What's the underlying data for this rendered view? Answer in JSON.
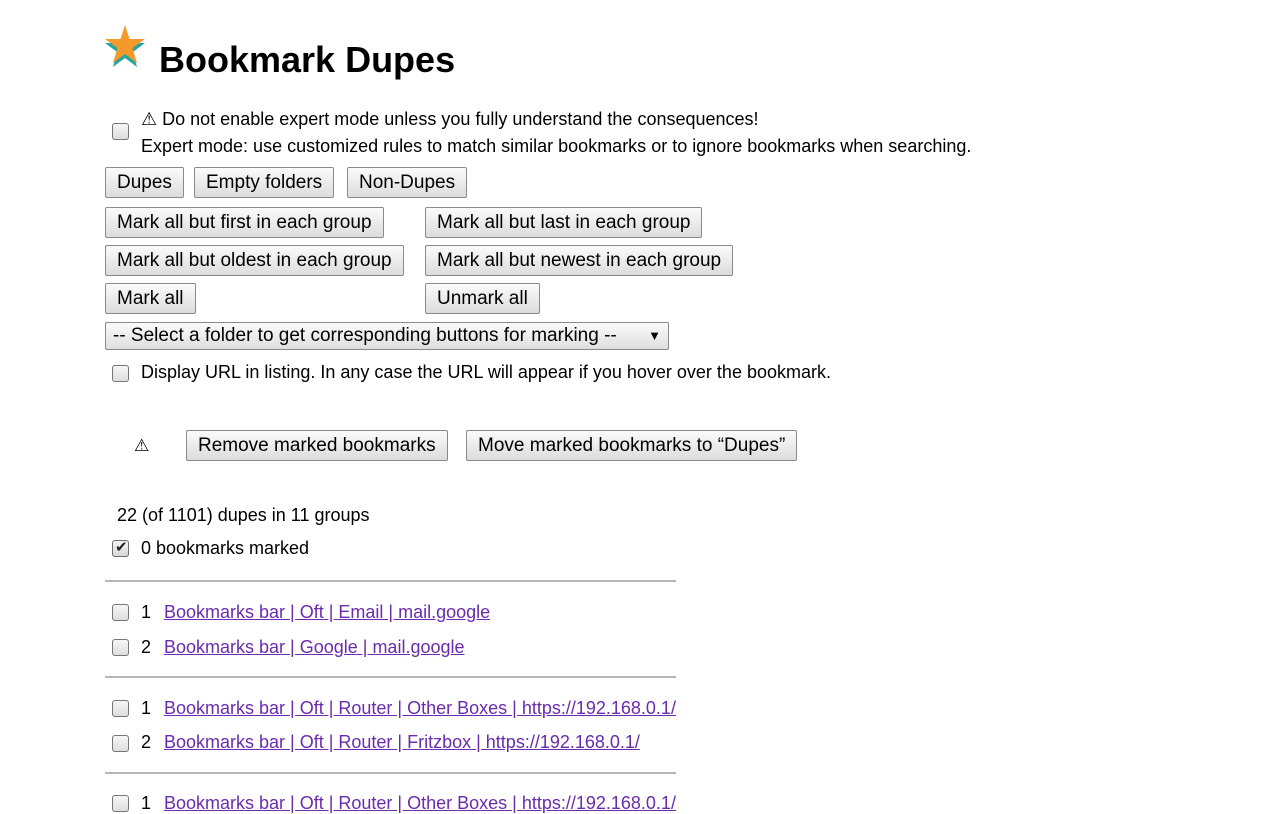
{
  "header": {
    "title": "Bookmark Dupes"
  },
  "expert": {
    "warning": "⚠ Do not enable expert mode unless you fully understand the consequences!",
    "label": "Expert mode: use customized rules to match similar bookmarks or to ignore bookmarks when searching."
  },
  "mode_buttons": {
    "dupes": "Dupes",
    "empty_folders": "Empty folders",
    "non_dupes": "Non-Dupes"
  },
  "mark_buttons": {
    "all_but_first": "Mark all but first in each group",
    "all_but_last": "Mark all but last in each group",
    "all_but_oldest": "Mark all but oldest in each group",
    "all_but_newest": "Mark all but newest in each group",
    "mark_all": "Mark all",
    "unmark_all": "Unmark all"
  },
  "folder_select": {
    "selected": "-- Select a folder to get corresponding buttons for marking --"
  },
  "display_url": {
    "label": "Display URL in listing. In any case the URL will appear if you hover over the bookmark."
  },
  "actions": {
    "warning_icon": "⚠",
    "remove": "Remove marked bookmarks",
    "move": "Move marked bookmarks to “Dupes”"
  },
  "summary": {
    "counts": "22 (of 1101) dupes in 11 groups",
    "marked": "0 bookmarks marked"
  },
  "groups": [
    {
      "items": [
        {
          "index": "1",
          "path": "Bookmarks bar | Oft | Email | mail.google"
        },
        {
          "index": "2",
          "path": "Bookmarks bar | Google | mail.google"
        }
      ]
    },
    {
      "items": [
        {
          "index": "1",
          "path": "Bookmarks bar | Oft | Router | Other Boxes | https://192.168.0.1/"
        },
        {
          "index": "2",
          "path": "Bookmarks bar | Oft | Router | Fritzbox | https://192.168.0.1/"
        }
      ]
    },
    {
      "items": [
        {
          "index": "1",
          "path": "Bookmarks bar | Oft | Router | Other Boxes | https://192.168.0.1/"
        }
      ]
    }
  ],
  "colors": {
    "link": "#6a2bad",
    "star_orange": "#f39a2b",
    "star_teal": "#2aa3a3"
  }
}
